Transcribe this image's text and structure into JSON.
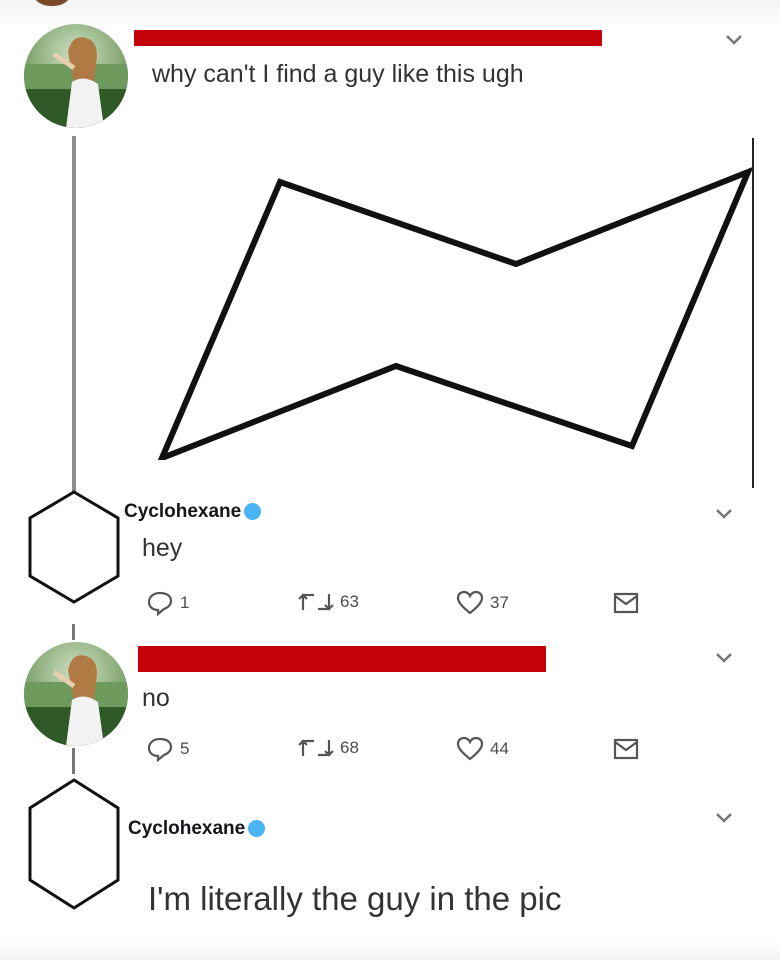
{
  "tweets": [
    {
      "author": "",
      "author_redacted": true,
      "avatar": "photo-avatar",
      "text": "why can't I find a guy like this ugh",
      "has_image": true,
      "image_icon": "cyclohexane-chair-drawing"
    },
    {
      "author": "Cyclohexane",
      "verified": true,
      "avatar": "hexagon-avatar",
      "text": "hey",
      "actions": {
        "replies": "1",
        "retweets": "63",
        "likes": "37"
      }
    },
    {
      "author": "",
      "author_redacted": true,
      "avatar": "photo-avatar",
      "text": "no",
      "actions": {
        "replies": "5",
        "retweets": "68",
        "likes": "44"
      }
    },
    {
      "author": "Cyclohexane",
      "verified": true,
      "avatar": "hexagon-avatar",
      "text": "I'm literally the guy in the pic"
    }
  ],
  "colors": {
    "redaction": "#c4000a",
    "verified": "#4ab3f4",
    "text": "#14171a",
    "muted": "#4d4d4d"
  }
}
